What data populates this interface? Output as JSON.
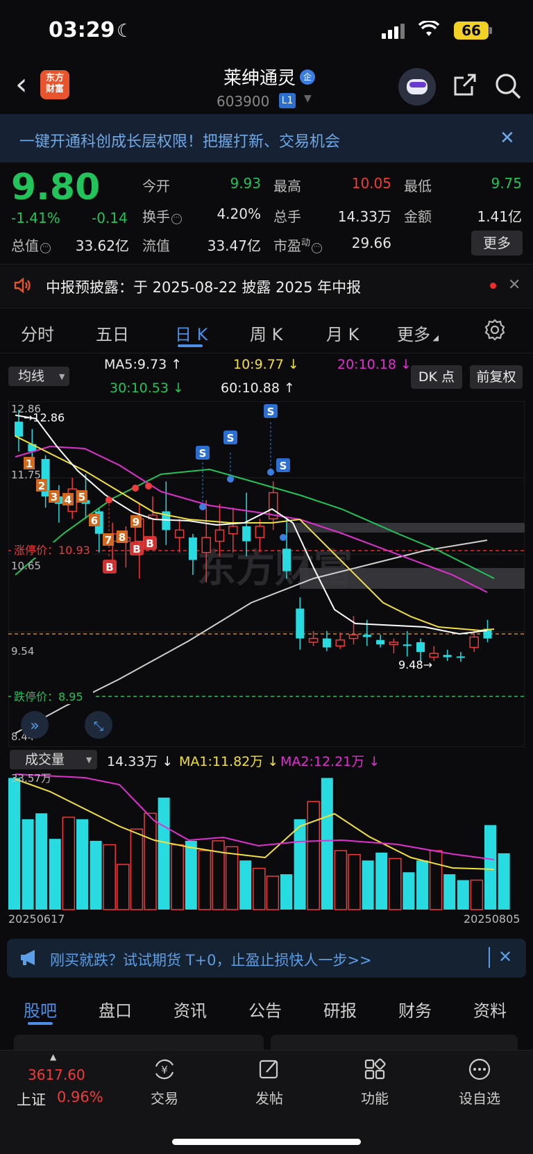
{
  "status_bar": {
    "time": "03:29",
    "battery": "66"
  },
  "header": {
    "logo_line1": "东方",
    "logo_line2": "财富",
    "name": "莱绅通灵",
    "badge": "企",
    "code": "603900",
    "level": "L1"
  },
  "banner": {
    "text": "一键开通科创成长层权限！把握打新、交易机会"
  },
  "quote": {
    "price": "9.80",
    "change_pct": "-1.41%",
    "change": "-0.14",
    "open_label": "今开",
    "open": "9.93",
    "high_label": "最高",
    "high": "10.05",
    "low_label": "最低",
    "low": "9.75",
    "turnover_label": "换手",
    "turnover": "4.20%",
    "volume_label": "总手",
    "volume": "14.33万",
    "amount_label": "金额",
    "amount": "1.41亿",
    "mktcap_label": "总值",
    "mktcap": "33.62亿",
    "float_label": "流值",
    "float": "33.47亿",
    "pe_label": "市盈",
    "pe_sup": "动",
    "pe": "29.66",
    "more": "更多"
  },
  "notice": {
    "text": "中报预披露：于 2025-08-22 披露 2025 年中报"
  },
  "period_tabs": [
    "分时",
    "五日",
    "日 K",
    "周 K",
    "月 K",
    "更多"
  ],
  "ma_bar": {
    "select": "均线",
    "ma5": "MA5:9.73 ↑",
    "ma10": "10:9.77 ↓",
    "ma20": "20:10.18 ↓",
    "ma30": "30:10.53 ↓",
    "ma60": "60:10.88 ↑",
    "dk": "DK 点",
    "adjust": "前复权"
  },
  "kline": {
    "y_top": "12.86",
    "y_mid1": "11.75",
    "y_mid2": "10.65",
    "y_low": "9.54",
    "y_bottom": "8.44",
    "high_mark": "12.86",
    "low_mark": "9.48",
    "limit_up": "涨停价：10.93",
    "limit_down": "跌停价：8.95",
    "watermark": "东方财富"
  },
  "volume": {
    "select": "成交量",
    "current": "14.33万 ↓",
    "ma1": "MA1:11.82万 ↓",
    "ma2": "MA2:12.21万 ↓",
    "max_label": "33.57万",
    "date_start": "20250617",
    "date_end": "20250805"
  },
  "chart_data": {
    "type": "candlestick",
    "candles": [
      {
        "o": 12.7,
        "c": 12.5,
        "h": 12.86,
        "l": 12.3
      },
      {
        "o": 12.4,
        "c": 12.3,
        "h": 12.6,
        "l": 12.1
      },
      {
        "o": 12.2,
        "c": 11.7,
        "h": 12.25,
        "l": 11.55
      },
      {
        "o": 11.7,
        "c": 11.6,
        "h": 11.85,
        "l": 11.35
      },
      {
        "o": 11.5,
        "c": 11.8,
        "h": 11.95,
        "l": 11.4
      },
      {
        "o": 11.65,
        "c": 11.6,
        "h": 12.0,
        "l": 11.4
      },
      {
        "o": 11.5,
        "c": 11.2,
        "h": 11.55,
        "l": 10.95
      },
      {
        "o": 11.1,
        "c": 11.2,
        "h": 11.35,
        "l": 10.85
      },
      {
        "o": 11.1,
        "c": 11.15,
        "h": 11.3,
        "l": 10.75
      },
      {
        "o": 11.1,
        "c": 11.4,
        "h": 11.6,
        "l": 10.6
      },
      {
        "o": 11.4,
        "c": 11.45,
        "h": 11.7,
        "l": 11.05
      },
      {
        "o": 11.5,
        "c": 11.25,
        "h": 11.9,
        "l": 11.05
      },
      {
        "o": 11.15,
        "c": 11.25,
        "h": 11.4,
        "l": 10.95
      },
      {
        "o": 11.15,
        "c": 10.85,
        "h": 11.2,
        "l": 10.65
      },
      {
        "o": 10.95,
        "c": 11.15,
        "h": 11.65,
        "l": 10.55
      },
      {
        "o": 11.1,
        "c": 11.25,
        "h": 11.6,
        "l": 10.9
      },
      {
        "o": 11.2,
        "c": 11.3,
        "h": 11.55,
        "l": 10.95
      },
      {
        "o": 11.3,
        "c": 11.1,
        "h": 11.75,
        "l": 10.9
      },
      {
        "o": 11.15,
        "c": 11.3,
        "h": 11.4,
        "l": 10.95
      },
      {
        "o": 11.4,
        "c": 11.75,
        "h": 11.9,
        "l": 11.25
      },
      {
        "o": 11.0,
        "c": 10.7,
        "h": 11.4,
        "l": 10.6
      },
      {
        "o": 10.2,
        "c": 9.8,
        "h": 10.35,
        "l": 9.65
      },
      {
        "o": 9.75,
        "c": 9.8,
        "h": 9.9,
        "l": 9.7
      },
      {
        "o": 9.8,
        "c": 9.68,
        "h": 9.9,
        "l": 9.63
      },
      {
        "o": 9.7,
        "c": 9.78,
        "h": 9.88,
        "l": 9.66
      },
      {
        "o": 9.8,
        "c": 9.85,
        "h": 10.1,
        "l": 9.72
      },
      {
        "o": 9.85,
        "c": 9.82,
        "h": 10.05,
        "l": 9.7
      },
      {
        "o": 9.78,
        "c": 9.72,
        "h": 9.85,
        "l": 9.68
      },
      {
        "o": 9.72,
        "c": 9.75,
        "h": 9.8,
        "l": 9.6
      },
      {
        "o": 9.72,
        "c": 9.7,
        "h": 9.9,
        "l": 9.56
      },
      {
        "o": 9.75,
        "c": 9.62,
        "h": 9.8,
        "l": 9.48
      },
      {
        "o": 9.55,
        "c": 9.6,
        "h": 9.7,
        "l": 9.5
      },
      {
        "o": 9.58,
        "c": 9.55,
        "h": 9.65,
        "l": 9.5
      },
      {
        "o": 9.56,
        "c": 9.56,
        "h": 9.62,
        "l": 9.49
      },
      {
        "o": 9.68,
        "c": 9.82,
        "h": 9.92,
        "l": 9.62
      },
      {
        "o": 9.93,
        "c": 9.8,
        "h": 10.05,
        "l": 9.75
      }
    ],
    "volume_values": [
      33.5,
      23,
      24.5,
      18,
      23.5,
      23,
      17.5,
      16.5,
      11.5,
      20.5,
      24.5,
      28.5,
      16.5,
      17.5,
      15,
      17.5,
      16,
      12.5,
      10.5,
      8.5,
      9,
      23,
      27.5,
      33.5,
      15,
      14,
      12.5,
      14.5,
      13,
      9.5,
      12.5,
      15,
      9,
      7.5,
      7.5,
      21.5,
      14.33
    ],
    "ylim": [
      8.44,
      12.86
    ]
  },
  "ad": {
    "text": "刚买就跌？试试期货 T+0，止盈止损快人一步>>"
  },
  "content_tabs": [
    "股吧",
    "盘口",
    "资讯",
    "公告",
    "研报",
    "财务",
    "资料"
  ],
  "index": {
    "value": "3617.60",
    "name": "上证",
    "pct": "0.96%"
  },
  "nav": {
    "trade": "交易",
    "post": "发帖",
    "func": "功能",
    "watch": "设自选"
  }
}
